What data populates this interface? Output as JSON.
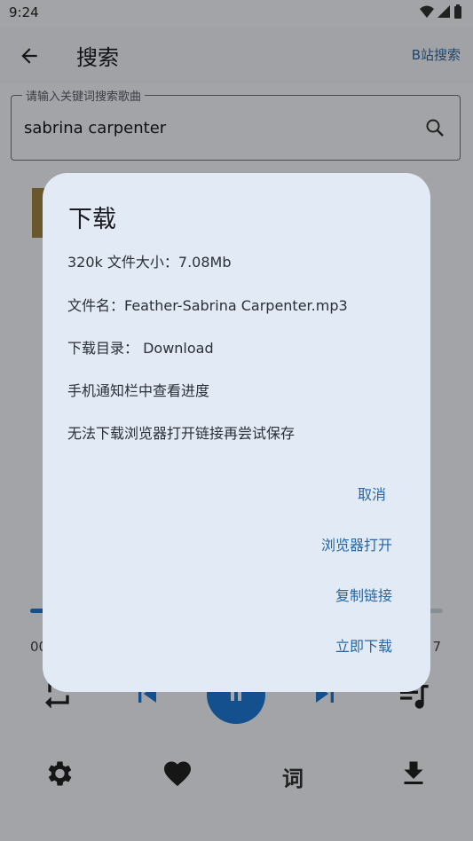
{
  "status": {
    "time": "9:24"
  },
  "header": {
    "title": "搜索",
    "bili_search": "B站搜索"
  },
  "search": {
    "label": "请输入关键词搜索歌曲",
    "value": "sabrina carpenter"
  },
  "player": {
    "time_left": "00",
    "time_right": "7",
    "progress": 0.05,
    "lyrics_label": "词"
  },
  "dialog": {
    "title": "下载",
    "lines": [
      "320k 文件大小：7.08Mb",
      "文件名：Feather-Sabrina Carpenter.mp3",
      "下载目录： Download",
      "手机通知栏中查看进度",
      "无法下载浏览器打开链接再尝试保存"
    ],
    "actions": [
      "取消",
      "浏览器打开",
      "复制链接",
      "立即下载"
    ]
  },
  "colors": {
    "accent": "#1e7ad6",
    "link": "#2567a4",
    "dialog_bg": "#e2eaf6"
  }
}
